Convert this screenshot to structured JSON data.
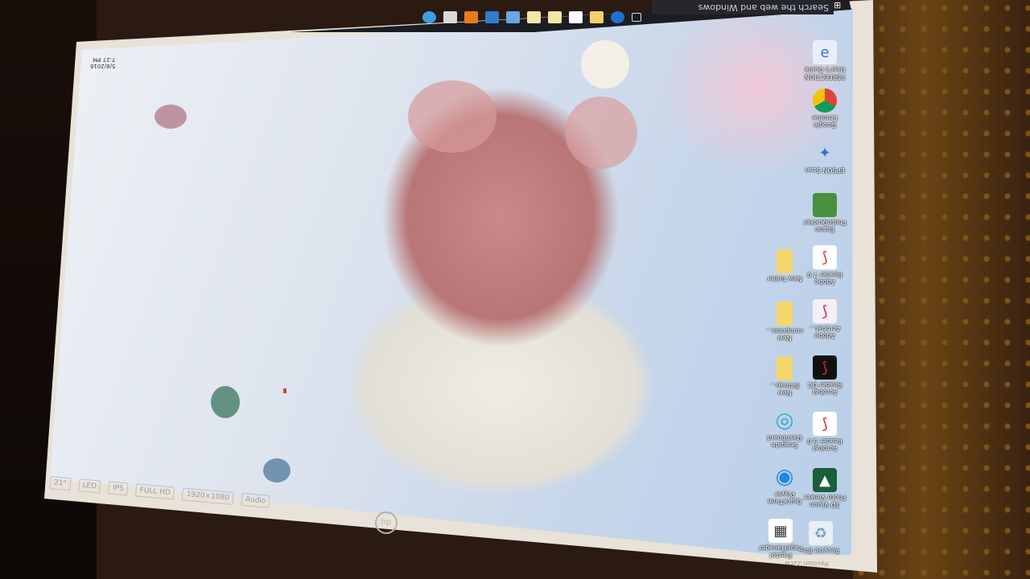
{
  "taskbar": {
    "search_placeholder": "Search the web and Windows",
    "pinned": [
      "edge-icon",
      "file-explorer-icon",
      "store-icon",
      "mail-icon",
      "office-icon",
      "file-icon",
      "skype-icon",
      "folder-icon",
      "ie-icon",
      "task-view-icon"
    ],
    "clock": "5/8/2016\n7:27 PM"
  },
  "desktop_icons": [
    {
      "name": "recycle-bin",
      "label": "Recycle Bin",
      "color": "#e7eef5"
    },
    {
      "name": "3d-vision",
      "label": "3D Vision\nPhoto Viewer",
      "color": "#2a7d4f"
    },
    {
      "name": "acrobat-reader-5",
      "label": "Acrobat\nReader 5.0",
      "color": "#ffffff"
    },
    {
      "name": "acrobat-reader-dc",
      "label": "Acrobat\nReader DC",
      "color": "#b81b1b"
    },
    {
      "name": "adobe-acrobat",
      "label": "Adobe\nAcrobat...",
      "color": "#f5f0f5"
    },
    {
      "name": "adobe-reader-7",
      "label": "Adobe\nReader 7.0",
      "color": "#e42a2a"
    },
    {
      "name": "epson-photoquicker",
      "label": "Epson\nPhotoQuicker",
      "color": "#4a8f3e"
    },
    {
      "name": "epson-scan",
      "label": "EPSON Scan",
      "color": "#3c6ecf"
    },
    {
      "name": "google-chrome",
      "label": "Google\nChrome",
      "color": "#f4c20d"
    },
    {
      "name": "users-guide",
      "label": "PERFECTION\nUser's Guide",
      "color": "#3a6fd4"
    },
    {
      "name": "presto-pagemanager",
      "label": "Presto!\nPageManager",
      "color": "#ffffff"
    },
    {
      "name": "quicktime",
      "label": "QuickTime\nPlayer",
      "color": "#1e88e5"
    },
    {
      "name": "seagate-dashboard",
      "label": "Seagate\nDashboard",
      "color": "#2aa6d6"
    },
    {
      "name": "new-bitmap",
      "label": "New\nBitmap...",
      "color": "#f4d76a"
    },
    {
      "name": "new-compressed",
      "label": "New\ncompress...",
      "color": "#f4d76a"
    },
    {
      "name": "new-folder",
      "label": "New folder",
      "color": "#f4d76a"
    }
  ],
  "bezel": {
    "stickers": [
      "21\"",
      "LED",
      "IPS",
      "FULL HD",
      "1920×1080",
      "Audio"
    ],
    "logo": "hp",
    "model": "Pavilion 22cw"
  }
}
